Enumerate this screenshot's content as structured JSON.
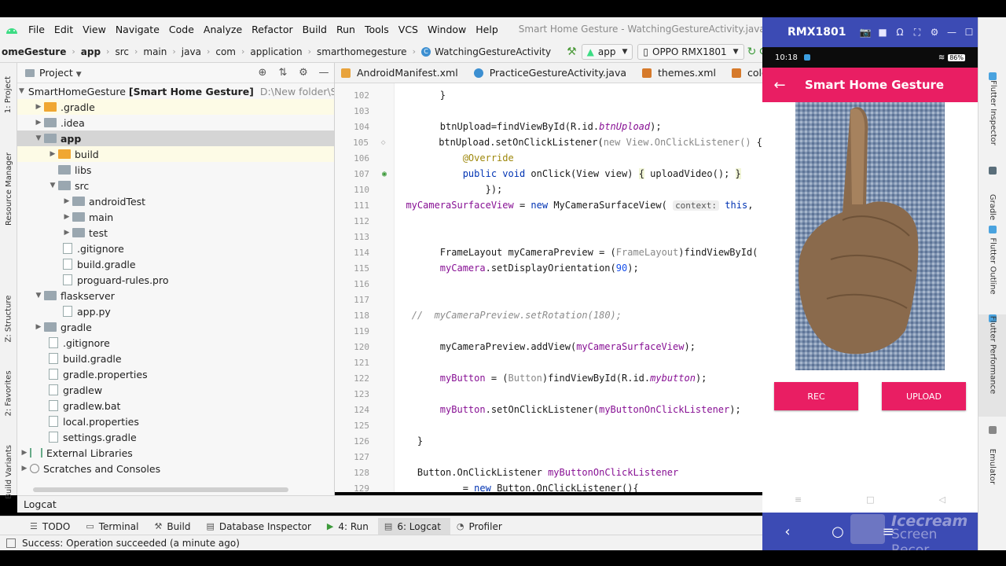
{
  "menubar": {
    "items": [
      "File",
      "Edit",
      "View",
      "Navigate",
      "Code",
      "Analyze",
      "Refactor",
      "Build",
      "Run",
      "Tools",
      "VCS",
      "Window",
      "Help"
    ],
    "window_title": "Smart Home Gesture - WatchingGestureActivity.java [Smart_Home_Ge"
  },
  "navbar": {
    "crumbs": [
      "omeGesture",
      "app",
      "src",
      "main",
      "java",
      "com",
      "application",
      "smarthomegesture",
      "WatchingGestureActivity"
    ],
    "run_config": "app",
    "device": "OPPO RMX1801"
  },
  "left_strip": {
    "tabs": [
      "1: Project",
      "Resource Manager",
      "Z: Structure",
      "2: Favorites",
      "Build Variants"
    ]
  },
  "project": {
    "header": "Project",
    "tree": [
      {
        "label": "SmartHomeGesture",
        "bold_suffix": "[Smart Home Gesture]",
        "path": "D:\\New folder\\SmartHo"
      },
      {
        "label": ".gradle"
      },
      {
        "label": ".idea"
      },
      {
        "label": "app"
      },
      {
        "label": "build"
      },
      {
        "label": "libs"
      },
      {
        "label": "src"
      },
      {
        "label": "androidTest"
      },
      {
        "label": "main"
      },
      {
        "label": "test"
      },
      {
        "label": ".gitignore"
      },
      {
        "label": "build.gradle"
      },
      {
        "label": "proguard-rules.pro"
      },
      {
        "label": "flaskserver"
      },
      {
        "label": "app.py"
      },
      {
        "label": "gradle"
      },
      {
        "label": ".gitignore"
      },
      {
        "label": "build.gradle"
      },
      {
        "label": "gradle.properties"
      },
      {
        "label": "gradlew"
      },
      {
        "label": "gradlew.bat"
      },
      {
        "label": "local.properties"
      },
      {
        "label": "settings.gradle"
      },
      {
        "label": "External Libraries"
      },
      {
        "label": "Scratches and Consoles"
      }
    ]
  },
  "editor": {
    "tabs": [
      "AndroidManifest.xml",
      "PracticeGestureActivity.java",
      "themes.xml",
      "colors.xm"
    ],
    "line_numbers": [
      "102",
      "103",
      "104",
      "105",
      "106",
      "107",
      "110",
      "111",
      "112",
      "113",
      "114",
      "115",
      "116",
      "117",
      "118",
      "119",
      "120",
      "121",
      "122",
      "123",
      "124",
      "125",
      "126",
      "127",
      "128",
      "129"
    ]
  },
  "logcat_label": "Logcat",
  "bottom_tools": [
    "TODO",
    "Terminal",
    "Build",
    "Database Inspector",
    "4: Run",
    "6: Logcat",
    "Profiler"
  ],
  "status_message": "Success: Operation succeeded (a minute ago)",
  "emulator": {
    "device_name": "RMX1801",
    "phone_time": "10:18",
    "battery": "86%",
    "app_title": "Smart Home Gesture",
    "rec_label": "REC",
    "upload_label": "UPLOAD",
    "watermark_line1": "Icecream",
    "watermark_line2": "Screen Recor"
  },
  "right_strip": {
    "tabs": [
      "Flutter Inspector",
      "Gradle",
      "Flutter Outline",
      "Flutter Performance",
      "Emulator"
    ]
  },
  "colors": {
    "accent_pink": "#e91e63",
    "emulator_blue": "#3c4bb4"
  }
}
